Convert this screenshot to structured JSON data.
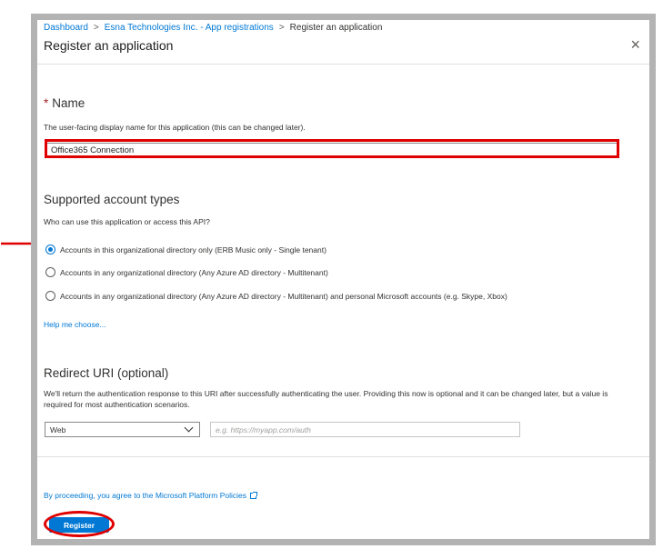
{
  "breadcrumb": {
    "items": [
      "Dashboard",
      "Esna Technologies Inc. - App registrations",
      "Register an application"
    ],
    "separator": ">"
  },
  "blade": {
    "title": "Register an application",
    "close_icon": "close-icon",
    "close_glyph": "×"
  },
  "name_section": {
    "required_mark": "*",
    "label": "Name",
    "description": "The user-facing display name for this application (this can be changed later).",
    "value": "Office365 Connection"
  },
  "account_types": {
    "heading": "Supported account types",
    "question": "Who can use this application or access this API?",
    "options": [
      {
        "label": "Accounts in this organizational directory only (ERB Music only - Single tenant)",
        "selected": true
      },
      {
        "label": "Accounts in any organizational directory (Any Azure AD directory - Multitenant)",
        "selected": false
      },
      {
        "label": "Accounts in any organizational directory (Any Azure AD directory - Multitenant) and personal Microsoft accounts (e.g. Skype, Xbox)",
        "selected": false
      }
    ],
    "help_link": "Help me choose..."
  },
  "redirect": {
    "heading": "Redirect URI (optional)",
    "description": "We'll return the authentication response to this URI after successfully authenticating the user. Providing this now is optional and it can be changed later, but a value is required for most authentication scenarios.",
    "platform_value": "Web",
    "uri_placeholder": "e.g. https://myapp.com/auth",
    "uri_value": ""
  },
  "footer": {
    "policy_text": "By proceeding, you agree to the Microsoft Platform Policies",
    "policy_icon": "external-link-icon",
    "register_label": "Register"
  },
  "annotations": {
    "highlight_color": "#e00000",
    "arrow_icon": "red-arrow-icon"
  },
  "colors": {
    "accent": "#0078d4",
    "frame_border": "#b3b3b3",
    "required": "#a4262c"
  }
}
